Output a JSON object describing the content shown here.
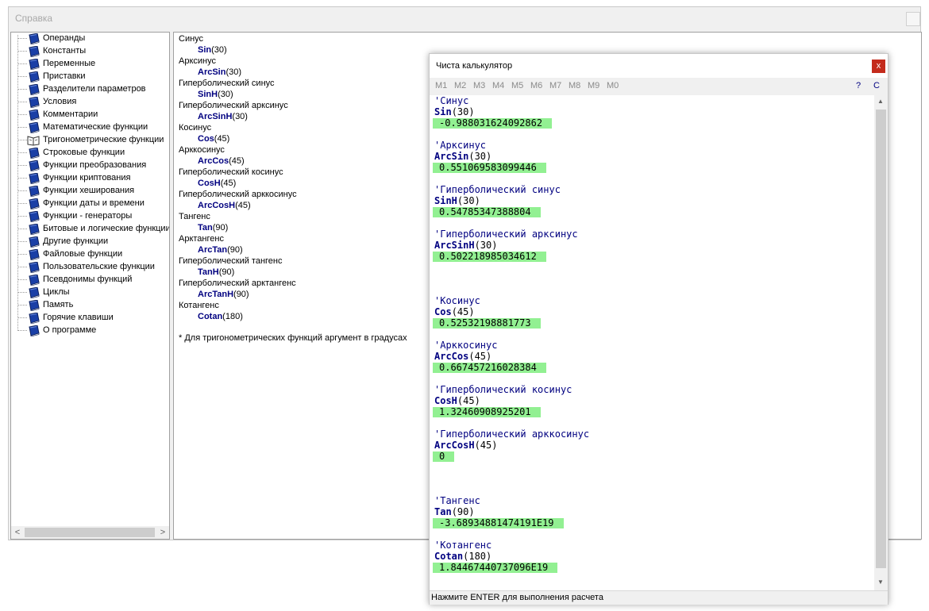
{
  "help_window": {
    "title": "Справка",
    "tree_items": [
      {
        "label": "Операнды",
        "icon": "book-icon"
      },
      {
        "label": "Константы",
        "icon": "book-icon"
      },
      {
        "label": "Переменные",
        "icon": "book-icon"
      },
      {
        "label": "Приставки",
        "icon": "book-icon"
      },
      {
        "label": "Разделители параметров",
        "icon": "book-icon"
      },
      {
        "label": "Условия",
        "icon": "book-icon"
      },
      {
        "label": "Комментарии",
        "icon": "book-icon"
      },
      {
        "label": "Математические функции",
        "icon": "book-icon"
      },
      {
        "label": "Тригонометрические функции",
        "icon": "open-book-icon",
        "selected": true
      },
      {
        "label": "Строковые функции",
        "icon": "book-icon"
      },
      {
        "label": "Функции преобразования",
        "icon": "book-icon"
      },
      {
        "label": "Функции криптования",
        "icon": "book-icon"
      },
      {
        "label": "Функции хеширования",
        "icon": "book-icon"
      },
      {
        "label": "Функции даты и времени",
        "icon": "book-icon"
      },
      {
        "label": "Функции - генераторы",
        "icon": "book-icon"
      },
      {
        "label": "Битовые и логические функции",
        "icon": "book-icon"
      },
      {
        "label": "Другие функции",
        "icon": "book-icon"
      },
      {
        "label": "Файловые функции",
        "icon": "book-icon"
      },
      {
        "label": "Пользовательские функции",
        "icon": "book-icon"
      },
      {
        "label": "Псевдонимы функций",
        "icon": "book-icon"
      },
      {
        "label": "Циклы",
        "icon": "book-icon"
      },
      {
        "label": "Память",
        "icon": "book-icon"
      },
      {
        "label": "Горячие клавиши",
        "icon": "book-icon"
      },
      {
        "label": "О программе",
        "icon": "book-icon"
      }
    ],
    "content": {
      "entries": [
        {
          "heading": "Синус",
          "fn": "Sin",
          "arg": "(30)"
        },
        {
          "heading": "Арксинус",
          "fn": "ArcSin",
          "arg": "(30)"
        },
        {
          "heading": "Гиперболический синус",
          "fn": "SinH",
          "arg": "(30)"
        },
        {
          "heading": "Гиперболический арксинус",
          "fn": "ArcSinH",
          "arg": "(30)"
        },
        {
          "heading": "Косинус",
          "fn": "Cos",
          "arg": "(45)"
        },
        {
          "heading": "Арккосинус",
          "fn": "ArcCos",
          "arg": "(45)"
        },
        {
          "heading": "Гиперболический косинус",
          "fn": "CosH",
          "arg": "(45)"
        },
        {
          "heading": "Гиперболический арккосинус",
          "fn": "ArcCosH",
          "arg": "(45)"
        },
        {
          "heading": "Тангенс",
          "fn": "Tan",
          "arg": "(90)"
        },
        {
          "heading": "Арктангенс",
          "fn": "ArcTan",
          "arg": "(90)"
        },
        {
          "heading": "Гиперболический тангенс",
          "fn": "TanH",
          "arg": "(90)"
        },
        {
          "heading": "Гиперболический арктангенс",
          "fn": "ArcTanH",
          "arg": "(90)"
        },
        {
          "heading": "Котангенс",
          "fn": "Cotan",
          "arg": "(180)"
        }
      ],
      "note": "* Для тригонометрических функций аргумент в градусах"
    },
    "scroll_left": "<",
    "scroll_right": ">"
  },
  "calc_window": {
    "title": "Чиста калькулятор",
    "close": "x",
    "memory_buttons": [
      "M1",
      "M2",
      "M3",
      "M4",
      "M5",
      "M6",
      "M7",
      "M8",
      "M9",
      "M0"
    ],
    "help_button": "?",
    "clear_button": "C",
    "blocks": [
      {
        "comment": "'Синус",
        "fn": "Sin",
        "arg": "(30)",
        "result": "-0.988031624092862"
      },
      {
        "comment": "'Арксинус",
        "fn": "ArcSin",
        "arg": "(30)",
        "result": "0.551069583099446"
      },
      {
        "comment": "'Гиперболический синус",
        "fn": "SinH",
        "arg": "(30)",
        "result": "0.54785347388804"
      },
      {
        "comment": "'Гиперболический арксинус",
        "fn": "ArcSinH",
        "arg": "(30)",
        "result": "0.502218985034612"
      },
      {
        "comment": "'Косинус",
        "fn": "Cos",
        "arg": "(45)",
        "result": "0.52532198881773"
      },
      {
        "comment": "'Арккосинус",
        "fn": "ArcCos",
        "arg": "(45)",
        "result": "0.667457216028384"
      },
      {
        "comment": "'Гиперболический косинус",
        "fn": "CosH",
        "arg": "(45)",
        "result": "1.32460908925201"
      },
      {
        "comment": "'Гиперболический арккосинус",
        "fn": "ArcCosH",
        "arg": "(45)",
        "result": "0"
      },
      {
        "comment": "'Тангенс",
        "fn": "Tan",
        "arg": "(90)",
        "result": "-3.68934881474191E19"
      },
      {
        "comment": "'Котангенс",
        "fn": "Cotan",
        "arg": "(180)",
        "result": "1.84467440737096E19"
      }
    ],
    "status": "Нажмите ENTER для выполнения расчета",
    "scroll_up": "▲",
    "scroll_down": "▼"
  },
  "colors": {
    "keyword": "#000080",
    "result_bg": "#92f092",
    "close_bg": "#c42b1c"
  }
}
